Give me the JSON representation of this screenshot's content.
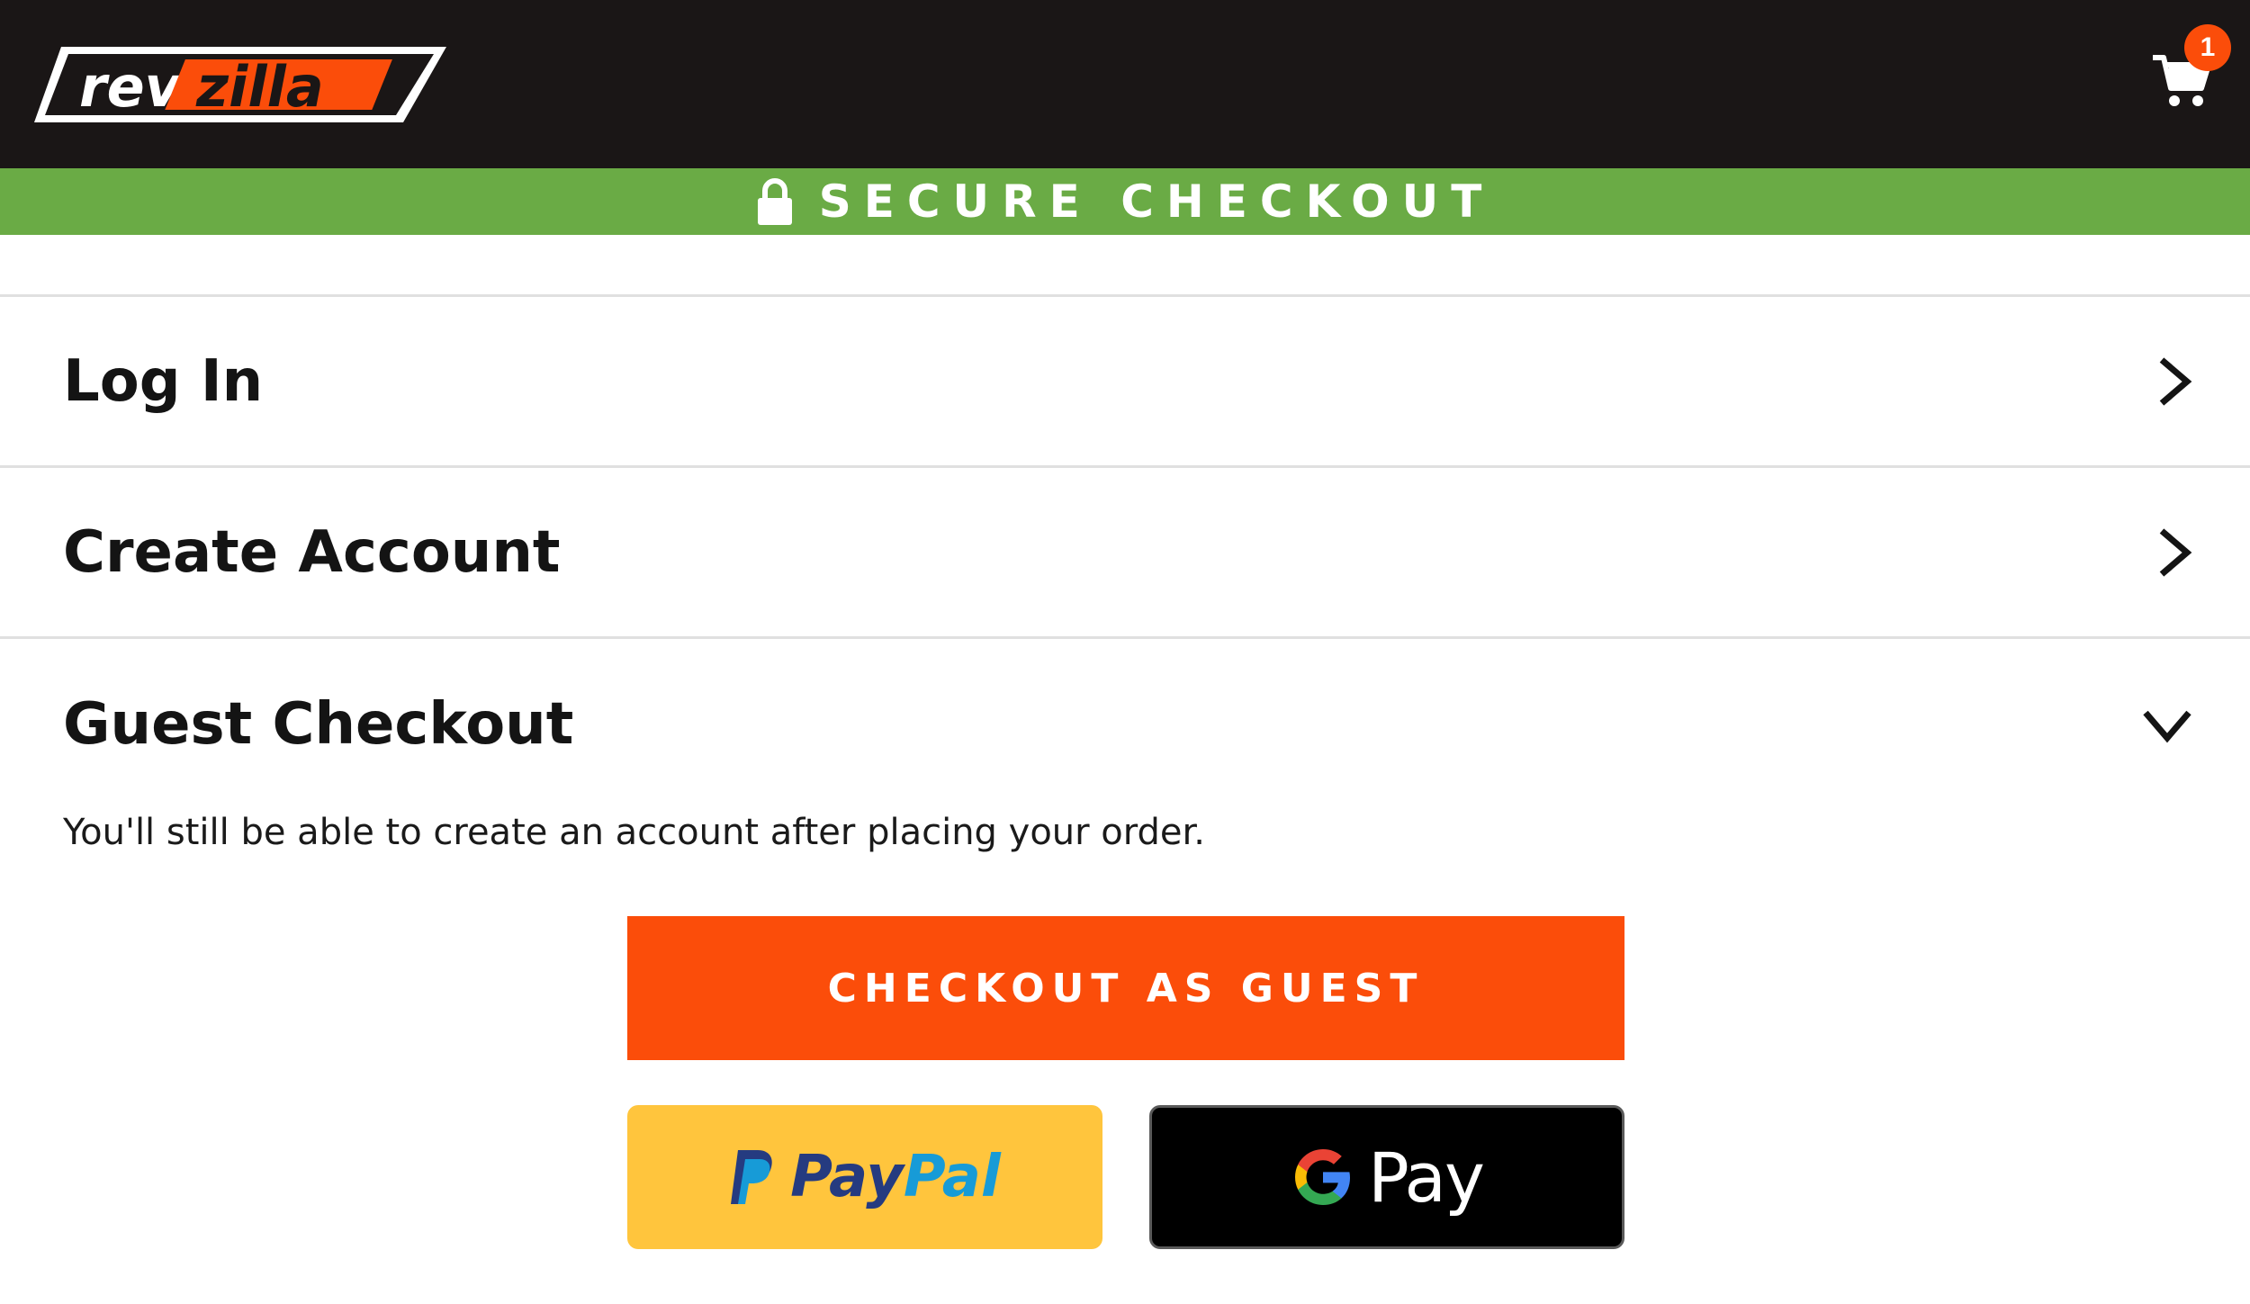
{
  "header": {
    "logo_text": "revzilla",
    "cart_count": "1"
  },
  "secure_bar": {
    "label": "SECURE CHECKOUT"
  },
  "sections": {
    "login": {
      "title": "Log In"
    },
    "create_account": {
      "title": "Create Account"
    },
    "guest_checkout": {
      "title": "Guest Checkout",
      "note": "You'll still be able to create an account after placing your order.",
      "button_label": "CHECKOUT AS GUEST"
    }
  },
  "payment_buttons": {
    "paypal": {
      "label_part1": "Pay",
      "label_part2": "Pal"
    },
    "google_pay": {
      "label": "Pay"
    }
  },
  "colors": {
    "header_bg": "#1a1616",
    "secure_bar_bg": "#6aab45",
    "accent_orange": "#fb4d0a",
    "paypal_yellow": "#ffc53d",
    "gpay_black": "#000000"
  },
  "icons": {
    "lock": "lock-icon",
    "cart": "cart-icon",
    "chevron_right": "chevron-right-icon",
    "chevron_down": "chevron-down-icon"
  }
}
